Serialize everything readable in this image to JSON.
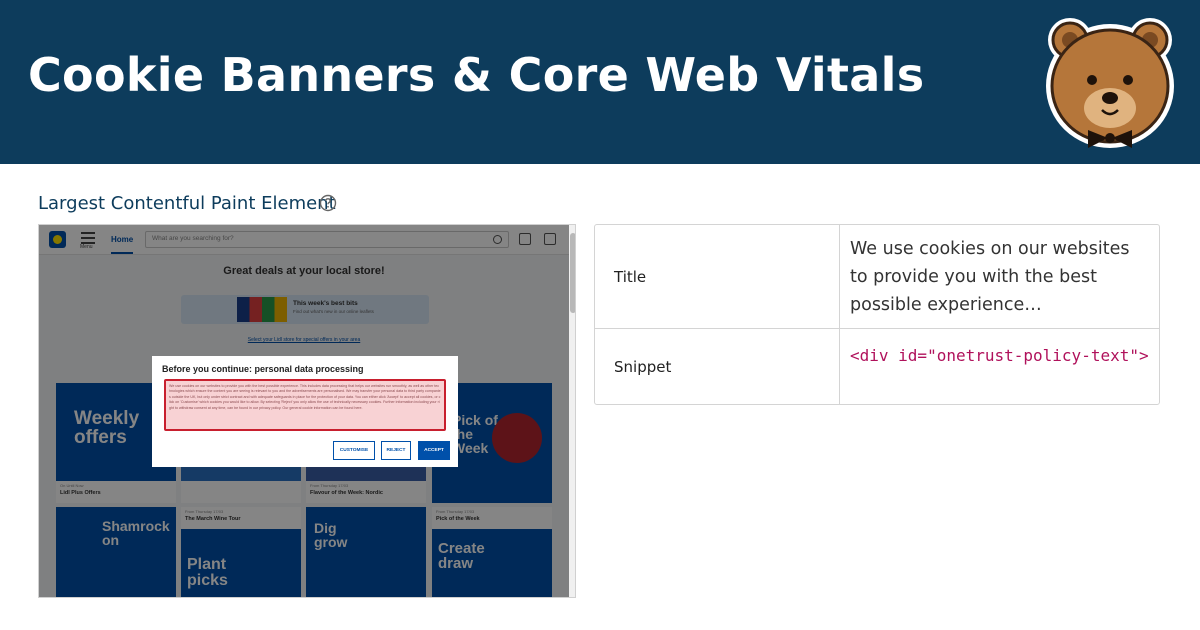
{
  "header": {
    "title": "Cookie Banners & Core Web Vitals",
    "mascot_icon": "bear-mascot-icon",
    "background_color": "#0d3c5c"
  },
  "section": {
    "title": "Largest Contentful Paint Element",
    "help_icon": "question-circle-icon"
  },
  "screenshot": {
    "topbar": {
      "menu_label": "Menu",
      "home_tab": "Home",
      "search_placeholder": "What are you searching for?"
    },
    "headline": "Great deals at your local store!",
    "best_bits": {
      "title": "This week's best bits",
      "subtitle": "Find out what's new in our online leaflets"
    },
    "store_link": "Select your Lidl store for special offers in your area",
    "tiles": [
      {
        "word": "Weekly offers",
        "caption_small": "On Until Now",
        "caption": "Lidl Plus Offers"
      },
      {
        "word": "",
        "caption_small": "",
        "caption": ""
      },
      {
        "word": "",
        "caption_small": "From Thursday 17/03",
        "caption": "Flavour of the Week: Nordic"
      },
      {
        "word": "Pick of the Week",
        "caption_small": "",
        "caption": ""
      },
      {
        "word": "Shamrock on",
        "caption_small": "From Thursday 17/03",
        "caption": "The March Wine Tour"
      },
      {
        "word": "Plant picks",
        "caption_small": "",
        "caption": ""
      },
      {
        "word": "Dig grow",
        "caption_small": "From Thursday 17/03",
        "caption": "Pick of the Week"
      },
      {
        "word": "Create draw",
        "caption_small": "",
        "caption": ""
      }
    ],
    "dialog": {
      "title": "Before you continue: personal data processing",
      "body": "We use cookies on our websites to provide you with the best possible experience. This includes data processing that helps our websites run smoothly, as well as other technologies which ensure the content you are seeing is relevant to you and the advertisements are personalised. We may transfer your personal data to third party companies outside the UK, but only under strict contract and with adequate safeguards in place for the protection of your data. You can either click 'Accept' to accept all cookies, or click on 'Customise' which cookies you would like to allow. By selecting 'Reject' you only allow the use of technically necessary cookies. Further information including your right to withdraw consent at any time, can be found in our privacy policy. Our general cookie information can be found here.",
      "customise": "CUSTOMISE",
      "reject": "REJECT",
      "accept": "ACCEPT",
      "highlight_color": "#c81f2e"
    }
  },
  "details": {
    "rows": [
      {
        "label": "Title",
        "value": "We use cookies on our websites to provide you with the best possible experience…"
      },
      {
        "label": "Snippet",
        "value": "<div id=\"onetrust-policy-text\">"
      }
    ],
    "code_color": "#b0115b"
  }
}
